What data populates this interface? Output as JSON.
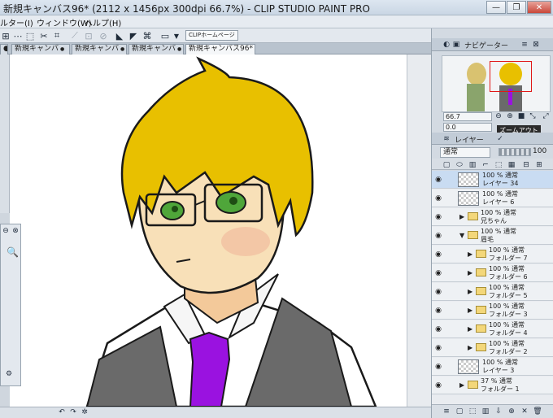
{
  "window": {
    "title": "新規キャンバス96* (2112 x 1456px 300dpi 66.7%)  - CLIP STUDIO PAINT PRO",
    "minimize": "—",
    "restore": "❐",
    "close": "✕"
  },
  "menu": {
    "items": [
      "ルター(I)",
      "ウィンドウ(W)",
      "ヘルプ(H)"
    ]
  },
  "toolbar": {
    "clip_home": "CLIPホームページ"
  },
  "tabs": [
    {
      "label": "新規キャンバ",
      "close": "●"
    },
    {
      "label": "新規キャンバ",
      "close": "●"
    },
    {
      "label": "新規キャンバ",
      "close": "●"
    },
    {
      "label": "新規キャンバス96*",
      "close": "●"
    }
  ],
  "navigator": {
    "title": "ナビゲーター",
    "zoom_value": "66.7",
    "rotate_value": "0.0",
    "tooltip": "ズームアウト"
  },
  "layer_panel": {
    "title": "レイヤー",
    "blend_mode": "通常",
    "opacity": "100"
  },
  "layers": [
    {
      "top": "100 % 通常",
      "name": "レイヤー 34",
      "type": "raster",
      "selected": true,
      "indent": 0
    },
    {
      "top": "100 % 通常",
      "name": "レイヤー 6",
      "type": "raster",
      "selected": false,
      "indent": 0
    },
    {
      "top": "100 % 通常",
      "name": "兄ちゃん",
      "type": "folder",
      "selected": false,
      "indent": 0
    },
    {
      "top": "100 % 通常",
      "name": "眉毛",
      "type": "folder-open",
      "selected": false,
      "indent": 0
    },
    {
      "top": "100 % 通常",
      "name": "フォルダー 7",
      "type": "folder",
      "selected": false,
      "indent": 1
    },
    {
      "top": "100 % 通常",
      "name": "フォルダー 6",
      "type": "folder",
      "selected": false,
      "indent": 1
    },
    {
      "top": "100 % 通常",
      "name": "フォルダー 5",
      "type": "folder",
      "selected": false,
      "indent": 1
    },
    {
      "top": "100 % 通常",
      "name": "フォルダー 3",
      "type": "folder",
      "selected": false,
      "indent": 1
    },
    {
      "top": "100 % 通常",
      "name": "フォルダー 4",
      "type": "folder",
      "selected": false,
      "indent": 1
    },
    {
      "top": "100 % 通常",
      "name": "フォルダー 2",
      "type": "folder",
      "selected": false,
      "indent": 1
    },
    {
      "top": "100 % 通常",
      "name": "レイヤー 3",
      "type": "raster",
      "selected": false,
      "indent": 0
    },
    {
      "top": "37 % 通常",
      "name": "フォルダー 1",
      "type": "folder",
      "selected": false,
      "indent": 0
    }
  ],
  "colors": {
    "hair": "#e8c000",
    "tie": "#9a12e0",
    "vest": "#6a6a6a",
    "eyes": "#4fa63a",
    "selection": "#c9dcf2",
    "nav_frame": "#e01818"
  }
}
